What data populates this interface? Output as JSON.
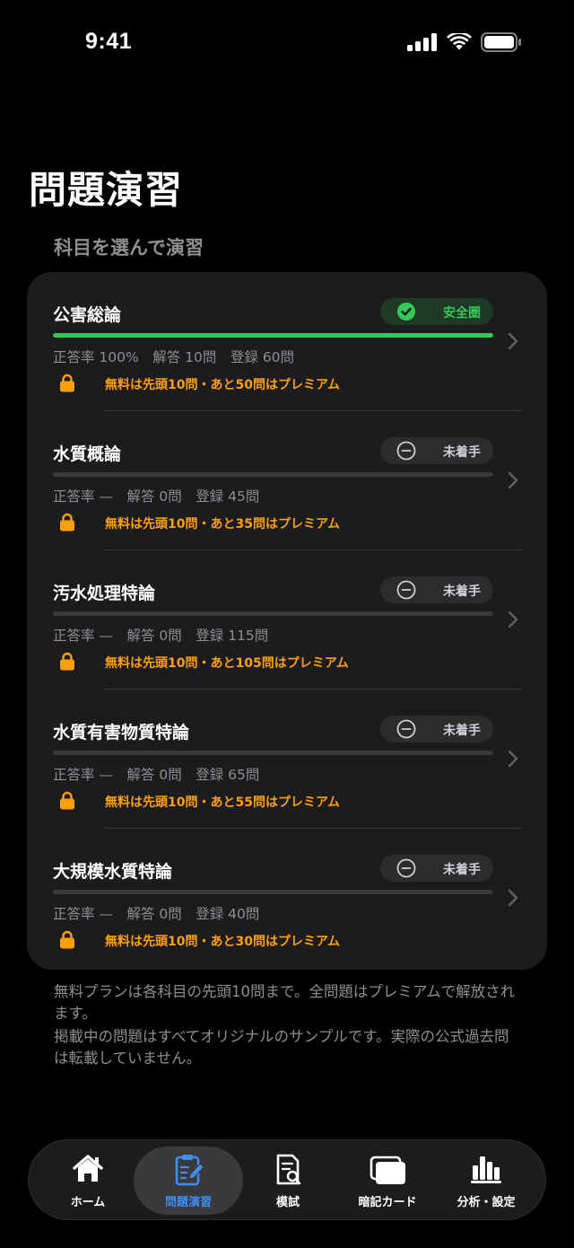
{
  "status": {
    "time": "9:41"
  },
  "title": "問題演習",
  "section_label": "科目を選んで演習",
  "subjects": [
    {
      "name": "公害総論",
      "badge": "安全圏",
      "badge_state": "safe",
      "progress_pct": 100,
      "stats": "正答率 100%　解答 10問　登録 60問",
      "premium_text": "無料は先頭10問・あと50問はプレミアム"
    },
    {
      "name": "水質概論",
      "badge": "未着手",
      "badge_state": "none",
      "progress_pct": 0,
      "stats": "正答率 —　解答 0問　登録 45問",
      "premium_text": "無料は先頭10問・あと35問はプレミアム"
    },
    {
      "name": "汚水処理特論",
      "badge": "未着手",
      "badge_state": "none",
      "progress_pct": 0,
      "stats": "正答率 —　解答 0問　登録 115問",
      "premium_text": "無料は先頭10問・あと105問はプレミアム"
    },
    {
      "name": "水質有害物質特論",
      "badge": "未着手",
      "badge_state": "none",
      "progress_pct": 0,
      "stats": "正答率 —　解答 0問　登録 65問",
      "premium_text": "無料は先頭10問・あと55問はプレミアム"
    },
    {
      "name": "大規模水質特論",
      "badge": "未着手",
      "badge_state": "none",
      "progress_pct": 0,
      "stats": "正答率 —　解答 0問　登録 40問",
      "premium_text": "無料は先頭10問・あと30問はプレミアム"
    }
  ],
  "notes": [
    "無料プランは各科目の先頭10問まで。全問題はプレミアムで解放されます。",
    "掲載中の問題はすべてオリジナルのサンプルです。実際の公式過去問は転載していません。"
  ],
  "tabs": [
    {
      "label": "ホーム",
      "icon": "house-icon",
      "active": false
    },
    {
      "label": "問題演習",
      "icon": "clipboard-pencil-icon",
      "active": true
    },
    {
      "label": "模試",
      "icon": "document-search-icon",
      "active": false
    },
    {
      "label": "暗記カード",
      "icon": "cards-icon",
      "active": false
    },
    {
      "label": "分析・設定",
      "icon": "bar-chart-icon",
      "active": false
    }
  ],
  "colors": {
    "accent": "#3d8ef7",
    "safe": "#34c759",
    "premium": "#ff9f0a",
    "card": "#1c1c1e"
  }
}
